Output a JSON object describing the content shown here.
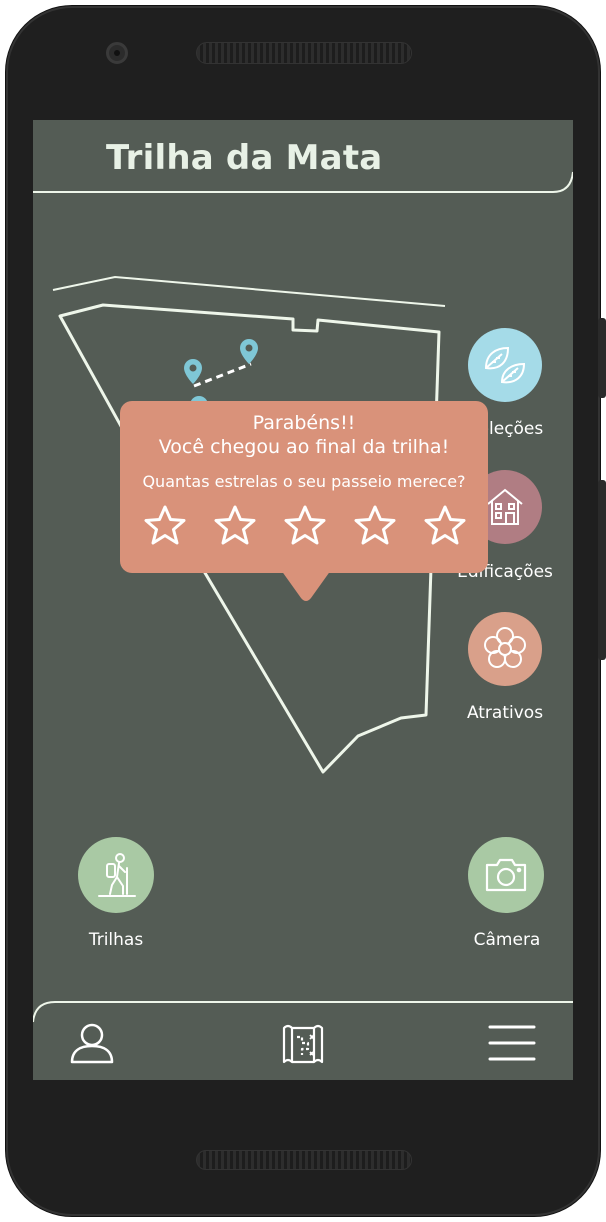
{
  "header": {
    "title": "Trilha da Mata"
  },
  "side_buttons": [
    {
      "label": "Coleções",
      "color": "#a5dbe8",
      "icon": "leaves-icon"
    },
    {
      "label": "Edificações",
      "color": "#b07d83",
      "icon": "house-icon"
    },
    {
      "label": "Atrativos",
      "color": "#d9a08a",
      "icon": "flower-icon"
    }
  ],
  "bottom_buttons": {
    "trails": {
      "label": "Trilhas",
      "color": "#a9c9a4",
      "icon": "hiker-icon"
    },
    "camera": {
      "label": "Câmera",
      "color": "#a9c9a4",
      "icon": "camera-icon"
    }
  },
  "popup": {
    "title_line1": "Parabéns!!",
    "title_line2": "Você chegou ao final da trilha!",
    "question": "Quantas estrelas o seu passeio merece?",
    "rating": {
      "value": 0,
      "max": 5
    },
    "color": "#d9927a"
  },
  "nav": {
    "items": [
      "profile-icon",
      "map-icon",
      "menu-icon"
    ]
  },
  "theme": {
    "screen_bg": "#545c55",
    "line_color": "#eef6ea",
    "pin_color": "#7fc7d6"
  }
}
